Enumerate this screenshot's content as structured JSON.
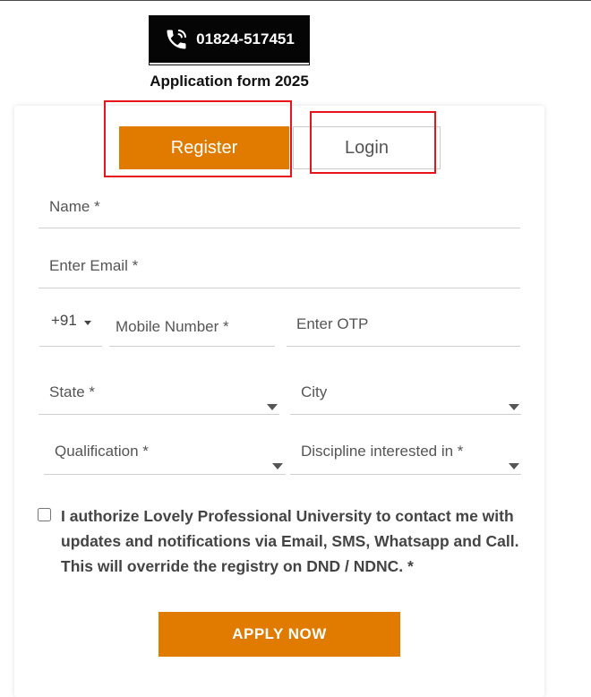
{
  "header": {
    "phone_number": "01824-517451",
    "phone_icon": "phone-call-icon",
    "form_title": "Application form 2025"
  },
  "tabs": {
    "register_label": "Register",
    "login_label": "Login"
  },
  "form": {
    "name_placeholder": "Name *",
    "email_placeholder": "Enter Email *",
    "country_code": "+91",
    "mobile_placeholder": "Mobile Number *",
    "otp_placeholder": "Enter OTP",
    "state_label": "State *",
    "city_label": "City",
    "qualification_label": "Qualification *",
    "discipline_label": "Discipline interested in *",
    "consent_text": "I authorize Lovely Professional University to contact me with updates and notifications via Email, SMS, Whatsapp and Call. This will override the registry on DND / NDNC. *",
    "apply_label": "APPLY NOW"
  },
  "colors": {
    "accent": "#e07b00",
    "highlight": "#e8141c",
    "badge_bg": "#050505"
  }
}
